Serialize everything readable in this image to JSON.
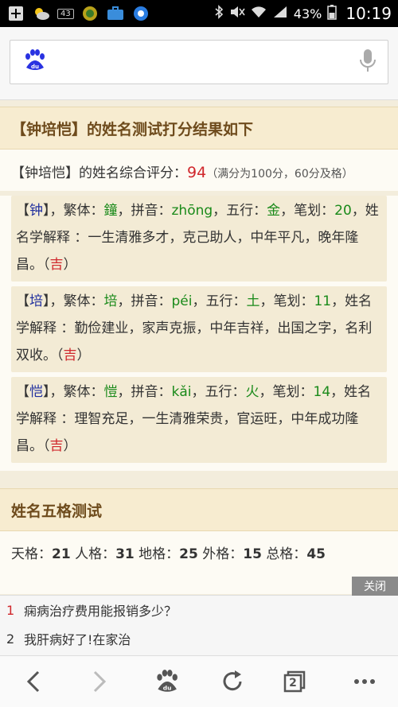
{
  "status_bar": {
    "notification_badge": "43",
    "battery": "43%",
    "time": "10:19"
  },
  "search": {
    "placeholder": ""
  },
  "result": {
    "title": "【钟培恺】的姓名测试打分结果如下",
    "summary_name": "【钟培恺】",
    "summary_text": "的姓名综合评分：",
    "score": "94",
    "score_note": "（满分为100分，60分及格）"
  },
  "characters": [
    {
      "char": "钟",
      "fanti_label": "，繁体：",
      "fanti": "鐘",
      "pinyin_label": "，拼音：",
      "pinyin": "zhōng",
      "wuxing_label": "，五行：",
      "wuxing": "金",
      "bihua_label": "，笔划：",
      "bihua": "20",
      "jieshi_label": "，姓名学解释 ：",
      "jieshi": "一生清雅多才，克己助人，中年平凡，晚年隆昌。（",
      "ji": "吉",
      "close": "）"
    },
    {
      "char": "培",
      "fanti_label": "，繁体：",
      "fanti": "培",
      "pinyin_label": "，拼音：",
      "pinyin": "péi",
      "wuxing_label": "，五行：",
      "wuxing": "土",
      "bihua_label": "，笔划：",
      "bihua": "11",
      "jieshi_label": "，姓名学解释 ：",
      "jieshi": "勤俭建业，家声克振，中年吉祥，出国之字，名利双收。（",
      "ji": "吉",
      "close": "）"
    },
    {
      "char": "恺",
      "fanti_label": "，繁体：",
      "fanti": "愷",
      "pinyin_label": "，拼音：",
      "pinyin": "kǎi",
      "wuxing_label": "，五行：",
      "wuxing": "火",
      "bihua_label": "，笔划：",
      "bihua": "14",
      "jieshi_label": "，姓名学解释 ：",
      "jieshi": "理智充足，一生清雅荣贵，官运旺，中年成功隆昌。（",
      "ji": "吉",
      "close": "）"
    }
  ],
  "wuge": {
    "title": "姓名五格测试",
    "tiange_label": "天格：",
    "tiange": "21",
    "renge_label": "人格：",
    "renge": "31",
    "dige_label": "地格：",
    "dige": "25",
    "waige_label": "外格：",
    "waige": "15",
    "zongge_label": "总格：",
    "zongge": "45"
  },
  "ad": {
    "close_label": "关闭",
    "items": [
      {
        "num": "1",
        "text": "痫病治疗费用能报销多少？"
      },
      {
        "num": "2",
        "text": "我肝病好了!在家治"
      }
    ]
  },
  "toolbar": {
    "tabs_count": "2"
  },
  "colors": {
    "accent_brown": "#6e4b1c",
    "score_red": "#d0272c",
    "wuxing_green": "#1a8a1a",
    "char_blue": "#1f2e9e",
    "baidu_blue": "#2932e1"
  }
}
